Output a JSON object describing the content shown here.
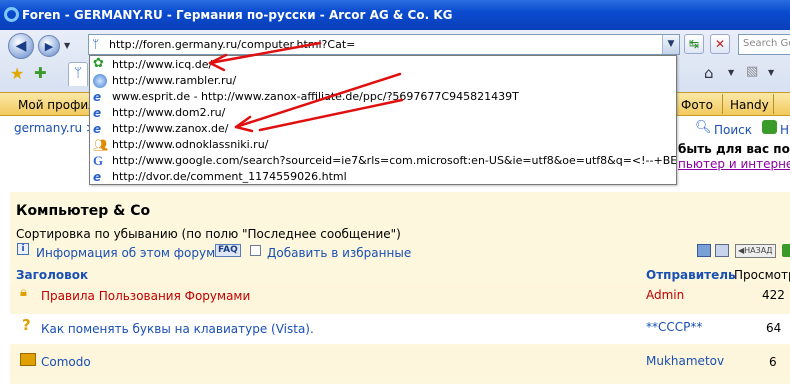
{
  "window": {
    "title": "Foren - GERMANY.RU - Германия по-русски - Arcor AG & Co. KG"
  },
  "address_bar": {
    "value": "http://foren.germany.ru/computer.html?Cat=",
    "search_placeholder": "Search Go"
  },
  "links_bar": {
    "left_item": "Мой профил",
    "right_items": [
      "Фото",
      "Handy"
    ]
  },
  "dropdown": {
    "items": [
      {
        "url": "http://www.icq.de/",
        "icon": "icq-flower-icon"
      },
      {
        "url": "http://www.rambler.ru/",
        "icon": "globe-icon"
      },
      {
        "url": "www.esprit.de - http://www.zanox-affiliate.de/ppc/?5697677C945821439T",
        "icon": "ie-page-icon"
      },
      {
        "url": "http://www.dom2.ru/",
        "icon": "ie-page-icon"
      },
      {
        "url": "http://www.zanox.de/",
        "icon": "ie-page-icon"
      },
      {
        "url": "http://www.odnoklassniki.ru/",
        "icon": "people-icon"
      },
      {
        "url": "http://www.google.com/search?sourceid=ie7&rls=com.microsoft:en-US&ie=utf8&oe=utf8&q=<!--+BEGINN+des+zan",
        "icon": "google-icon"
      },
      {
        "url": "http://dvor.de/comment_1174559026.html",
        "icon": "ie-page-icon"
      }
    ]
  },
  "page": {
    "breadcrumb": "germany.ru >",
    "search_link": "Поиск",
    "right_text_1": "быть для вас пол",
    "right_text_2": "пьютер и интерне",
    "forum_title": "Компьютер & Co",
    "sort_text": "Сортировка по убыванию (по полю \"Последнее сообщение\")",
    "info_link": "Информация об этом форуме",
    "faq_badge": "FAQ",
    "favorites_link": "Добавить в избранные",
    "back_label": "НАЗАД",
    "columns": {
      "title": "Заголовок",
      "sender": "Отправитель",
      "views": "Просмотр"
    },
    "rows": [
      {
        "title": "Правила Пользования Форумами",
        "sender": "Admin",
        "views": "422",
        "icon": "lock-icon"
      },
      {
        "title": "Как поменять буквы на клавиатуре (Vista).",
        "sender": "**CCCP**",
        "views": "64",
        "icon": "question-icon"
      },
      {
        "title": "Comodo",
        "sender": "Mukhametov",
        "views": "6",
        "icon": "folder-icon"
      }
    ]
  },
  "colors": {
    "title_bar": "#0a4bd0",
    "links_bar": "#f2c95d",
    "forum_bg": "#fcf7dd",
    "link_blue": "#1a4fb4",
    "link_red": "#c00000",
    "arrow_red": "#e01010"
  }
}
